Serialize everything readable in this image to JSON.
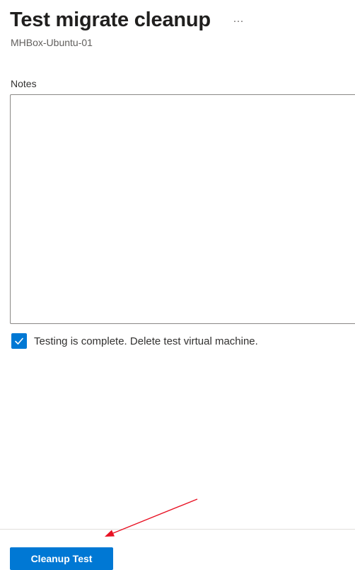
{
  "header": {
    "title": "Test migrate cleanup",
    "more_label": "···",
    "subtitle": "MHBox-Ubuntu-01"
  },
  "form": {
    "notes_label": "Notes",
    "notes_value": "",
    "confirm_checked": true,
    "confirm_label": "Testing is complete. Delete test virtual machine."
  },
  "footer": {
    "primary_button_label": "Cleanup Test"
  },
  "colors": {
    "accent": "#0078d4",
    "annotation_arrow": "#e81123"
  },
  "icons": {
    "more": "more-ellipsis-icon",
    "checkmark": "checkmark-icon",
    "annotation": "red-arrow-icon"
  }
}
